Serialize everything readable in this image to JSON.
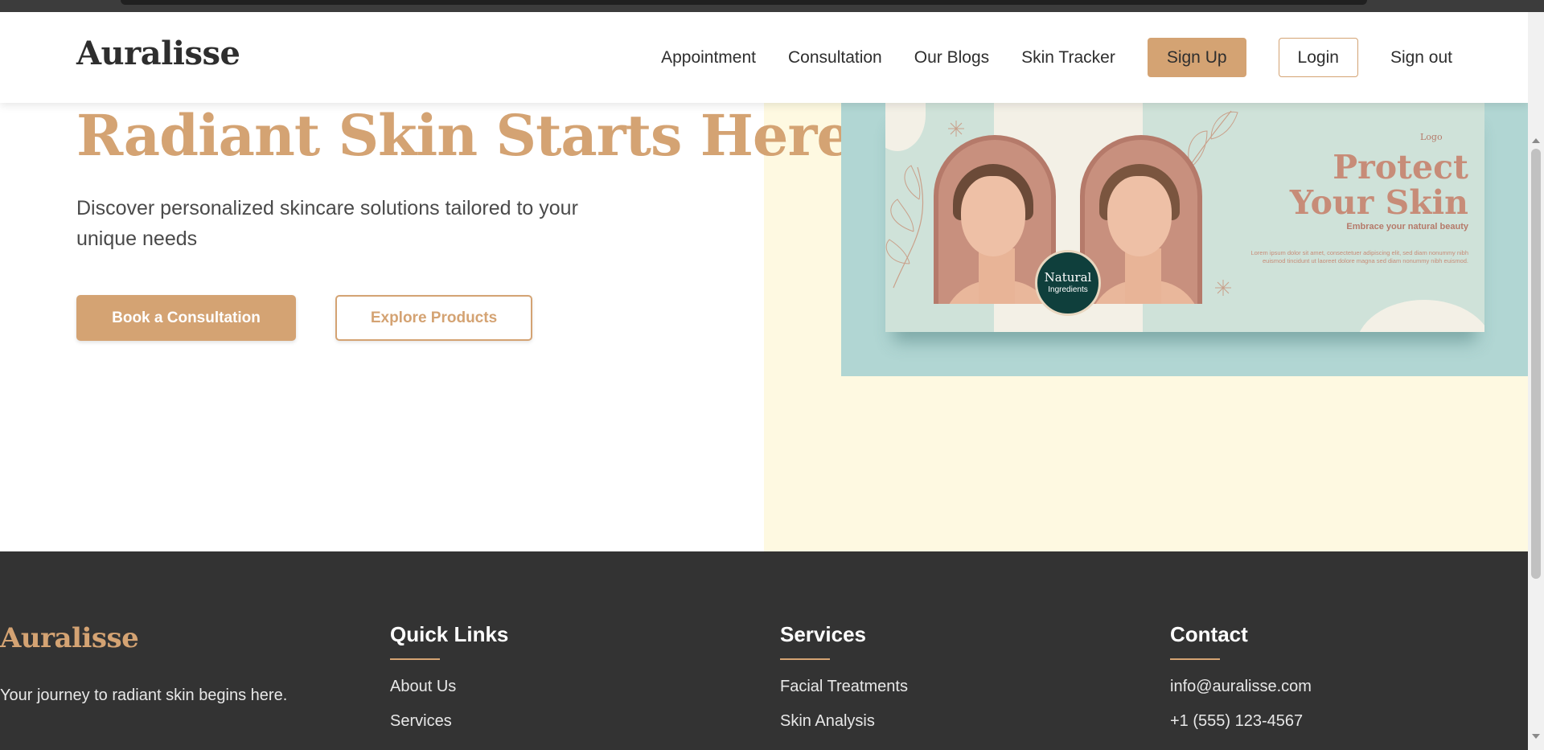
{
  "header": {
    "logo": "Auralisse",
    "nav": {
      "appointment": "Appointment",
      "consultation": "Consultation",
      "our_blogs": "Our Blogs",
      "skin_tracker": "Skin Tracker",
      "sign_up": "Sign Up",
      "login": "Login",
      "sign_out": "Sign out"
    }
  },
  "hero": {
    "title": "Radiant Skin Starts Here",
    "subtitle": "Discover personalized skincare solutions tailored to your unique needs",
    "primary_button": "Book a Consultation",
    "secondary_button": "Explore Products",
    "image": {
      "logo_text": "Logo",
      "headline_line1": "Protect",
      "headline_line2": "Your Skin",
      "tagline": "Embrace your natural beauty",
      "body": "Lorem ipsum dolor sit amet, consectetuer adipiscing elit, sed diam nonummy nibh euismod tincidunt ut laoreet dolore magna sed diam nonummy nibh euismod.",
      "badge_line1": "Natural",
      "badge_line2": "Ingredients"
    }
  },
  "footer": {
    "brand": "Auralisse",
    "tagline": "Your journey to radiant skin begins here.",
    "quick_links": {
      "heading": "Quick Links",
      "items": [
        "About Us",
        "Services"
      ]
    },
    "services": {
      "heading": "Services",
      "items": [
        "Facial Treatments",
        "Skin Analysis"
      ]
    },
    "contact": {
      "heading": "Contact",
      "email": "info@auralisse.com",
      "phone": "+1 (555) 123-4567"
    }
  },
  "colors": {
    "accent": "#d4a373",
    "hero_right_bg": "#fef9e1",
    "footer_bg": "#333333",
    "banner_bg": "#b1d6d3"
  }
}
